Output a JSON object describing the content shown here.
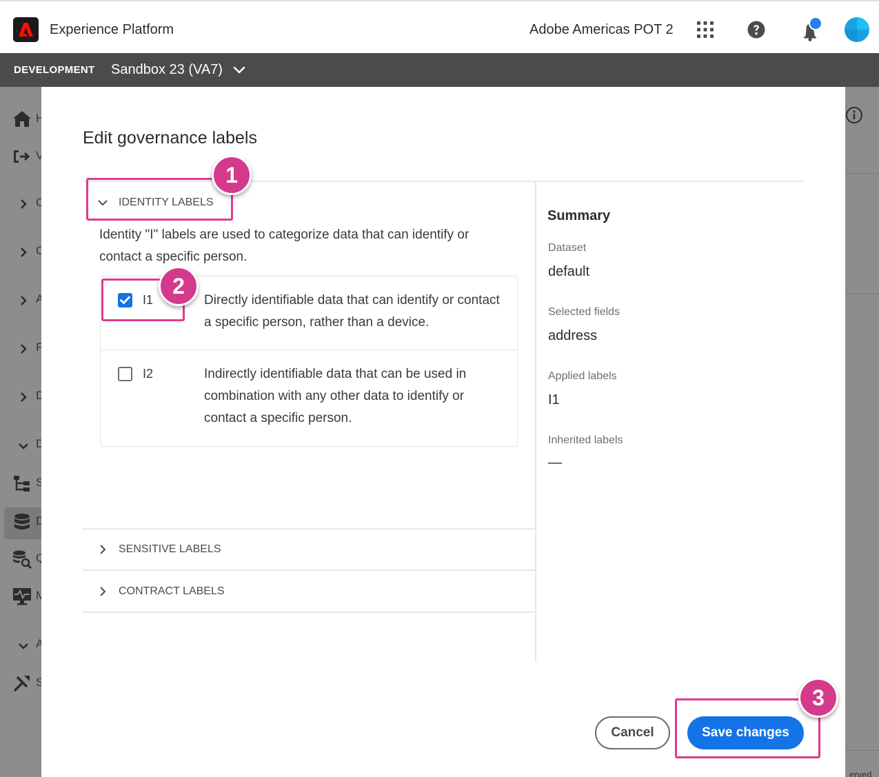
{
  "header": {
    "app_title": "Experience Platform",
    "org_name": "Adobe Americas POT 2"
  },
  "sandbox": {
    "environment": "DEVELOPMENT",
    "name": "Sandbox 23 (VA7)"
  },
  "background": {
    "nav_peek": [
      "H",
      "V",
      "C",
      "C",
      "A",
      "P",
      "D",
      "D",
      "S",
      "D",
      "Q",
      "M",
      "A",
      "S"
    ],
    "footer_peek": "erved"
  },
  "dialog": {
    "title": "Edit governance labels",
    "sections": {
      "identity": {
        "header": "IDENTITY LABELS",
        "description": "Identity \"I\" labels are used to categorize data that can identify or contact a specific person.",
        "labels": [
          {
            "code": "I1",
            "description": "Directly identifiable data that can identify or contact a specific person, rather than a device.",
            "checked": true
          },
          {
            "code": "I2",
            "description": "Indirectly identifiable data that can be used in combination with any other data to identify or contact a specific person.",
            "checked": false
          }
        ]
      },
      "sensitive": {
        "header": "SENSITIVE LABELS"
      },
      "contract": {
        "header": "CONTRACT LABELS"
      }
    },
    "summary": {
      "title": "Summary",
      "dataset_label": "Dataset",
      "dataset_value": "default",
      "selected_fields_label": "Selected fields",
      "selected_fields_value": "address",
      "applied_labels_label": "Applied labels",
      "applied_labels_value": "I1",
      "inherited_labels_label": "Inherited labels",
      "inherited_labels_value": "—"
    },
    "buttons": {
      "cancel": "Cancel",
      "save": "Save changes"
    }
  },
  "callouts": [
    "1",
    "2",
    "3"
  ],
  "colors": {
    "accent": "#1473e6",
    "callout": "#e2398a",
    "sandbox_bar": "#4b4b4b",
    "backdrop": "#8d8d8d"
  }
}
